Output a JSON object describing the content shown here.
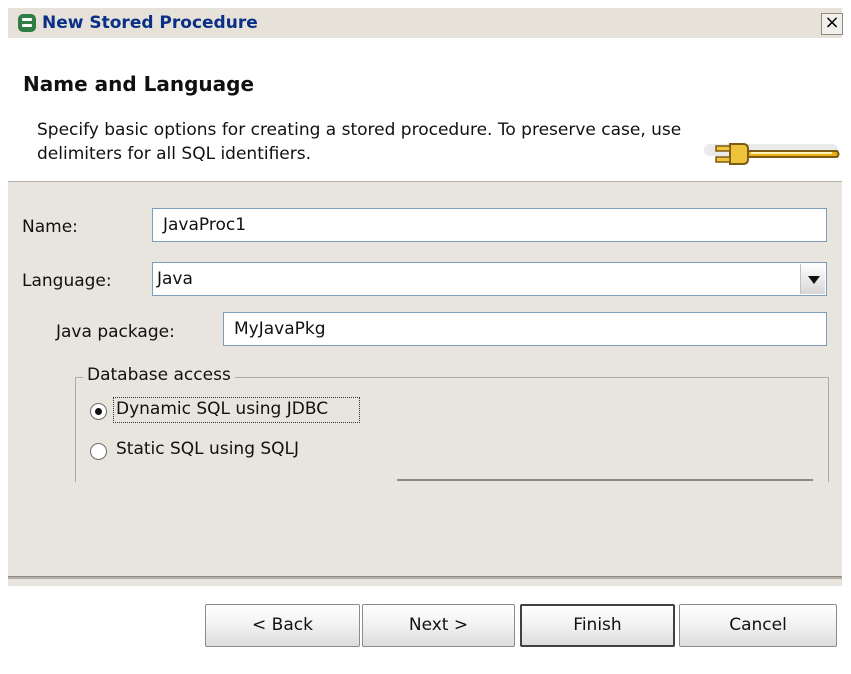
{
  "window": {
    "title": "New Stored Procedure",
    "close_label": "×"
  },
  "header": {
    "title": "Name and Language",
    "description": "Specify basic options for creating a stored procedure. To preserve case, use delimiters for all SQL identifiers.",
    "icon": "plug-icon"
  },
  "form": {
    "name_label": "Name:",
    "name_value": "JavaProc1",
    "language_label": "Language:",
    "language_value": "Java",
    "java_package_label": "Java package:",
    "java_package_value": "MyJavaPkg",
    "database_access": {
      "legend": "Database access",
      "options": [
        {
          "label": "Dynamic SQL using JDBC",
          "selected": true
        },
        {
          "label": "Static SQL using SQLJ",
          "selected": false
        }
      ]
    }
  },
  "buttons": {
    "back": "< Back",
    "next": "Next >",
    "finish": "Finish",
    "cancel": "Cancel"
  },
  "colors": {
    "title_text": "#0a2f86",
    "dialog_bg": "#e7e5de",
    "plug_gold": "#e8b11b"
  }
}
